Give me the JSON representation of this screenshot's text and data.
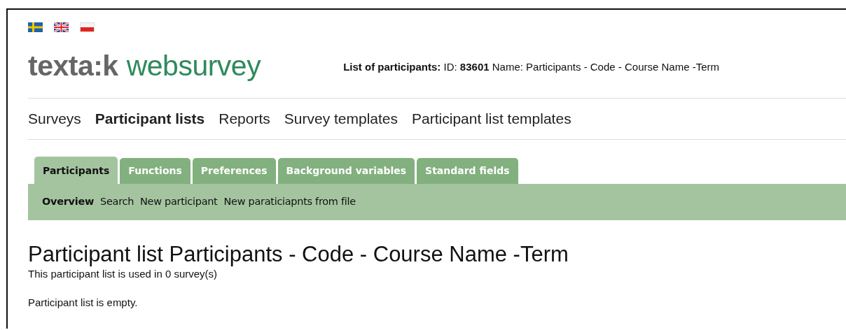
{
  "logo": {
    "brand": "texta:k",
    "product": "websurvey"
  },
  "header_info": "**List of participants:** ID: **83601** Name: Participants - Code - Course Name -Term",
  "main_nav": [
    {
      "label": "Surveys",
      "selected": false
    },
    {
      "label": "Participant lists",
      "selected": true
    },
    {
      "label": "Reports",
      "selected": false
    },
    {
      "label": "Survey templates",
      "selected": false
    },
    {
      "label": "Participant list templates",
      "selected": false
    }
  ],
  "tabs": [
    {
      "label": "Participants",
      "selected": true
    },
    {
      "label": "Functions",
      "selected": false
    },
    {
      "label": "Preferences",
      "selected": false
    },
    {
      "label": "Background variables",
      "selected": false
    },
    {
      "label": "Standard fields",
      "selected": false
    }
  ],
  "sub_nav": [
    {
      "label": "Overview",
      "selected": true
    },
    {
      "label": "Search",
      "selected": false
    },
    {
      "label": "New participant",
      "selected": false
    },
    {
      "label": "New paraticiapnts from file",
      "selected": false
    }
  ],
  "heading": "Participant list Participants - Code - Course Name -Term",
  "usage_note": "This participant list is used in 0 survey(s)",
  "empty_message": "Participant list is empty."
}
